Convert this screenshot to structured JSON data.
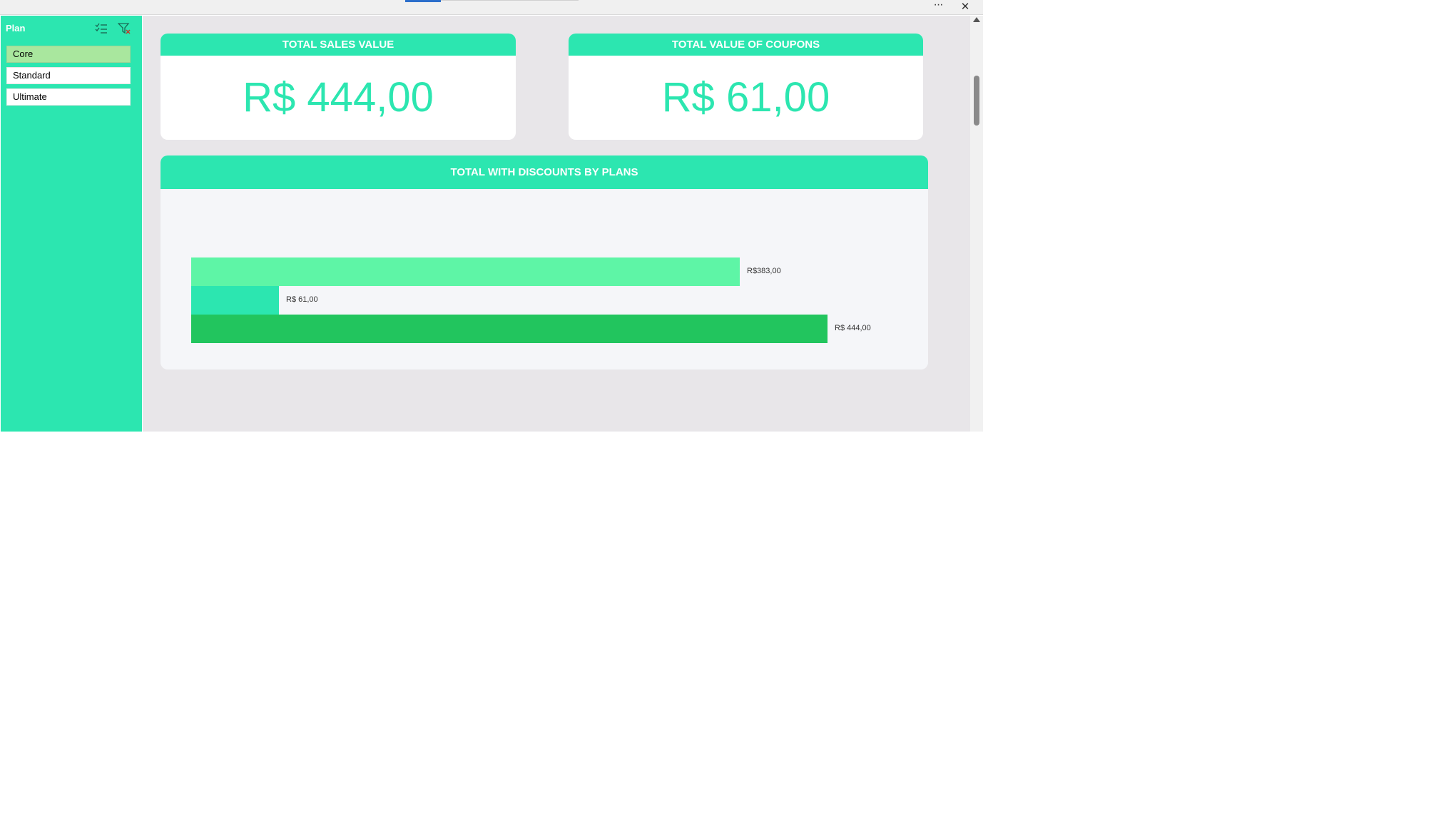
{
  "window": {
    "more_icon": "ellipsis-icon",
    "more_label": "···",
    "close_icon": "close-icon",
    "close_label": "✕"
  },
  "slicer": {
    "title": "Plan",
    "multi_select_icon": "multi-select-icon",
    "clear_filter_icon": "clear-filter-icon",
    "items": [
      {
        "label": "Core",
        "selected": true
      },
      {
        "label": "Standard",
        "selected": false
      },
      {
        "label": "Ultimate",
        "selected": false
      }
    ]
  },
  "kpis": [
    {
      "title": "TOTAL SALES VALUE",
      "value": "R$ 444,00"
    },
    {
      "title": "TOTAL VALUE OF COUPONS",
      "value": "R$ 61,00"
    }
  ],
  "colors": {
    "accent": "#2ce6b0",
    "selected_item": "#a9e79e",
    "bar_light": "#5ef5a6",
    "bar_teal": "#2ce6b0",
    "bar_green": "#22c55e"
  },
  "chart_data": {
    "type": "bar",
    "orientation": "horizontal",
    "title": "TOTAL WITH DISCOUNTS BY PLANS",
    "xlim": [
      0,
      444
    ],
    "series": [
      {
        "value": 383,
        "label": "R$383,00",
        "color": "#5ef5a6"
      },
      {
        "value": 61,
        "label": "R$ 61,00",
        "color": "#2ce6b0"
      },
      {
        "value": 444,
        "label": "R$ 444,00",
        "color": "#22c55e"
      }
    ]
  }
}
